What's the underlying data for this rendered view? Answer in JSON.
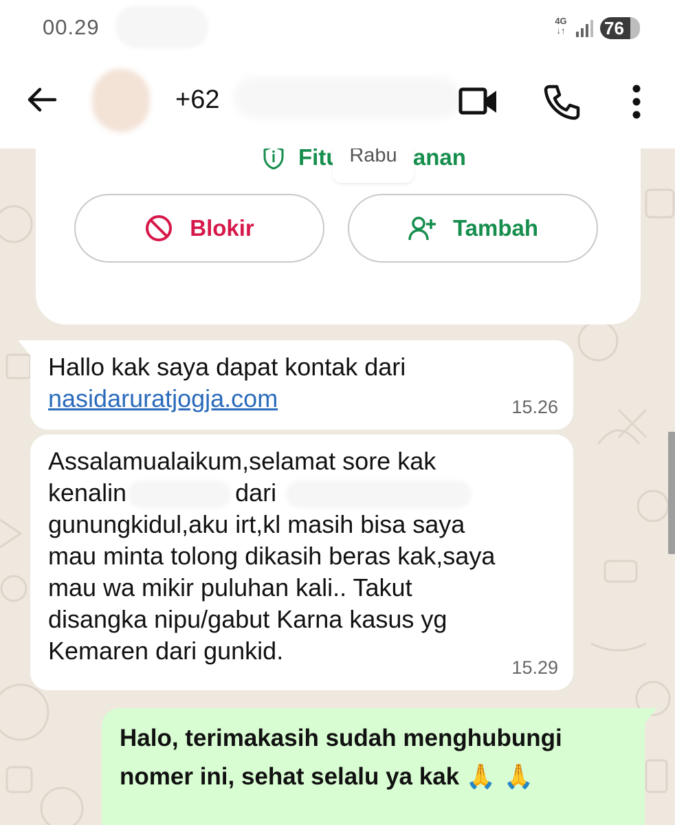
{
  "status_bar": {
    "time": "00.29",
    "network": "4G",
    "battery": "76",
    "icons": [
      "network-4g-icon",
      "signal-icon",
      "battery-icon"
    ]
  },
  "header": {
    "contact_name": "+62",
    "icons": [
      "back-arrow-icon",
      "video-call-icon",
      "phone-icon",
      "more-vert-icon"
    ]
  },
  "chat": {
    "security_label": "Fitur keamanan",
    "date_chip": "Rabu",
    "block_button": "Blokir",
    "add_button": "Tambah",
    "messages": [
      {
        "direction": "incoming",
        "text": "Hallo kak saya dapat kontak dari",
        "link": "nasidaruratjogja.com",
        "time": "15.26"
      },
      {
        "direction": "incoming",
        "lines": [
          "Assalamualaikum,selamat sore kak",
          "kenalin",
          "dari",
          "gunungkidul,aku irt,kl masih bisa saya",
          "mau minta tolong dikasih beras kak,saya",
          "mau wa mikir puluhan kali.. Takut",
          "disangka nipu/gabut Karna kasus yg",
          "Kemaren dari gunkid."
        ],
        "time": "15.29"
      },
      {
        "direction": "outgoing",
        "lines": [
          "Halo, terimakasih sudah menghubungi",
          "nomer ini, sehat selalu ya kak"
        ],
        "emoji": "🙏 🙏"
      }
    ]
  },
  "colors": {
    "accent_green": "#168e4d",
    "block_red": "#d6184a",
    "link_blue": "#2a6bbb",
    "outgoing_bubble": "#d9fdd3",
    "chat_background": "#eee8df"
  }
}
